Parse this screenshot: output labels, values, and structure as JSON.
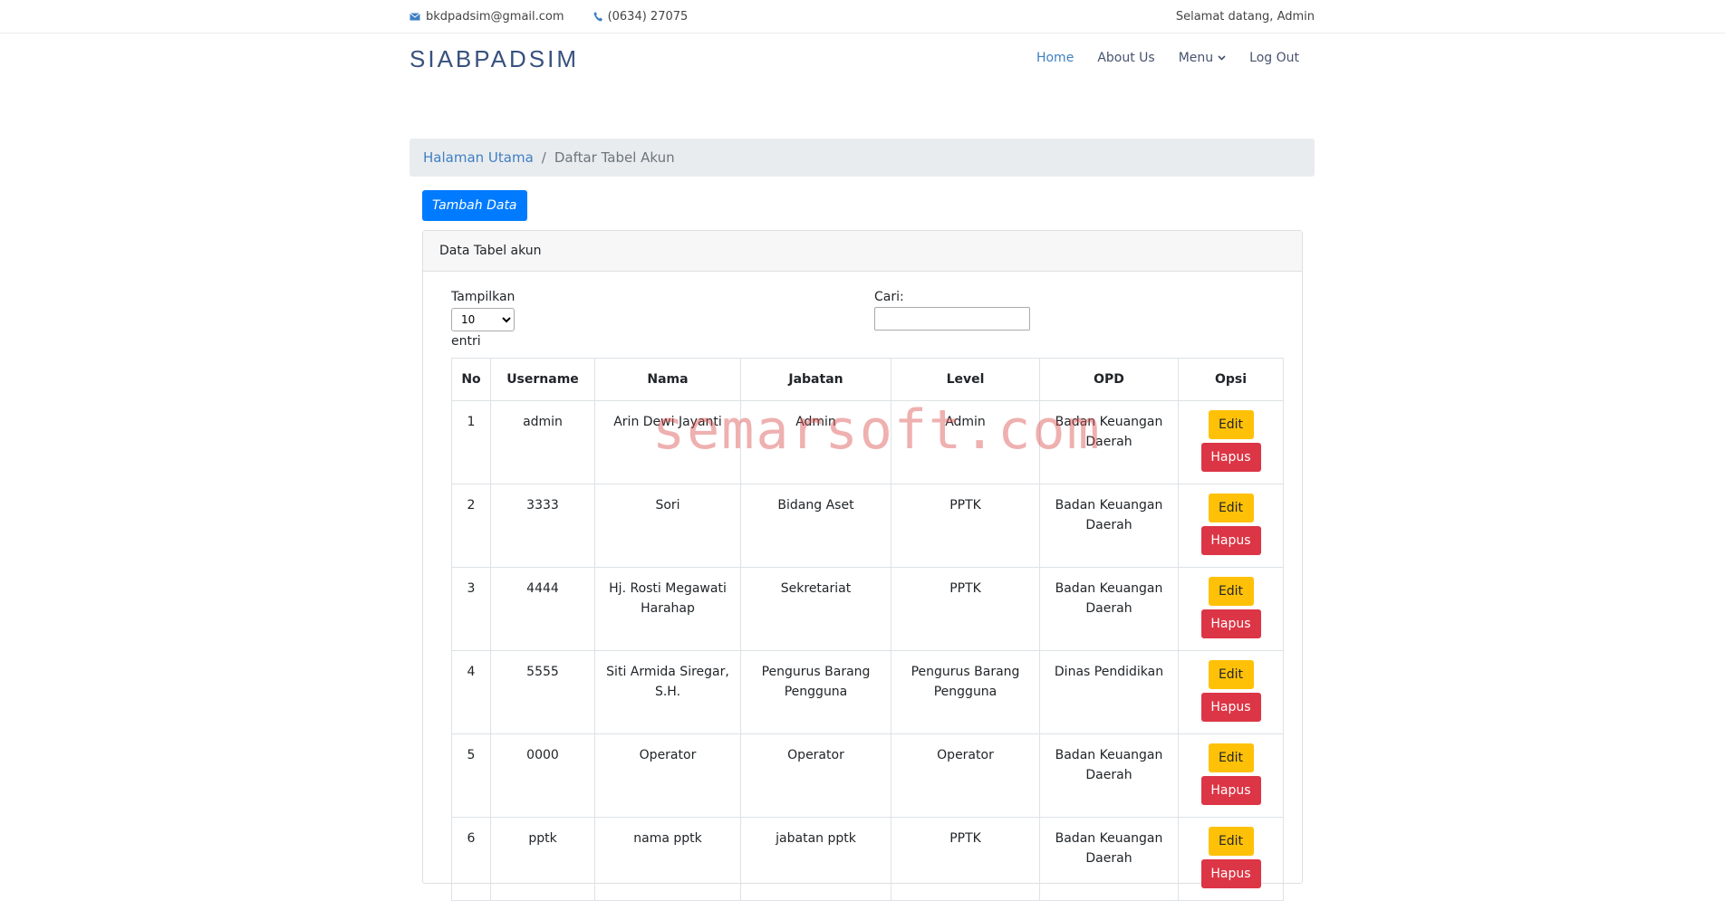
{
  "topbar": {
    "email": "bkdpadsim@gmail.com",
    "phone": "(0634) 27075",
    "welcome": "Selamat datang, Admin"
  },
  "header": {
    "brand": "SIABPADSIM",
    "nav": [
      "Home",
      "About Us",
      "Menu",
      "Log Out"
    ]
  },
  "breadcrumb": {
    "home": "Halaman Utama",
    "separator": "/",
    "current": "Daftar Tabel Akun"
  },
  "add_button": "Tambah Data",
  "card": {
    "title": "Data Tabel akun",
    "length_label": "Tampilkan",
    "length_value": "10",
    "length_suffix": "entri",
    "search_label": "Cari:",
    "search_value": ""
  },
  "table": {
    "headers": [
      "No",
      "Username",
      "Nama",
      "Jabatan",
      "Level",
      "OPD",
      "Opsi"
    ],
    "rows": [
      [
        "1",
        "admin",
        "Arin Dewi Jayanti",
        "Admin",
        "Admin",
        "Badan Keuangan Daerah"
      ],
      [
        "2",
        "3333",
        "Sori",
        "Bidang Aset",
        "PPTK",
        "Badan Keuangan Daerah"
      ],
      [
        "3",
        "4444",
        "Hj. Rosti Megawati Harahap",
        "Sekretariat",
        "PPTK",
        "Badan Keuangan Daerah"
      ],
      [
        "4",
        "5555",
        "Siti Armida Siregar, S.H.",
        "Pengurus Barang Pengguna",
        "Pengurus Barang Pengguna",
        "Dinas Pendidikan"
      ],
      [
        "5",
        "0000",
        "Operator",
        "Operator",
        "Operator",
        "Badan Keuangan Daerah"
      ],
      [
        "6",
        "pptk",
        "nama pptk",
        "jabatan pptk",
        "PPTK",
        "Badan Keuangan Daerah"
      ]
    ],
    "edit_label": "Edit",
    "delete_label": "Hapus"
  },
  "watermark": "semarsoft.com",
  "colors": {
    "primary": "#007bff",
    "warning": "#ffc107",
    "danger": "#dc3545",
    "brand": "#37517e",
    "link": "#3e7fc1"
  }
}
